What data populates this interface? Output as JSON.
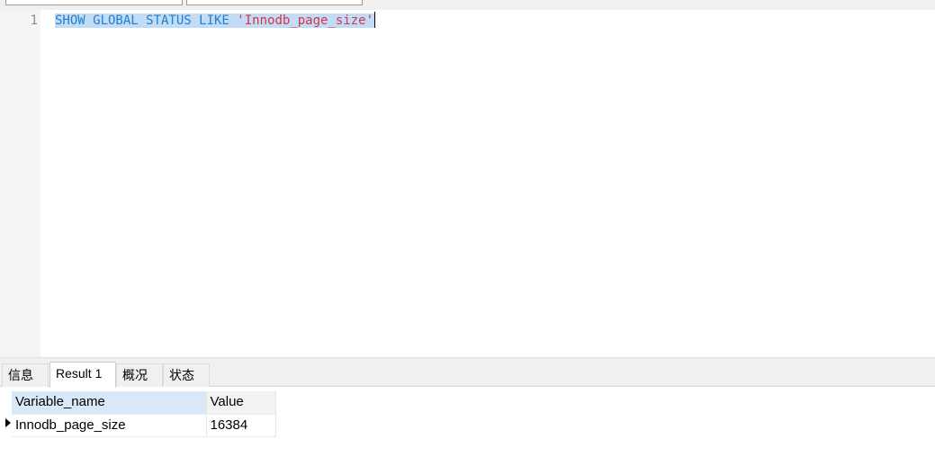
{
  "editor": {
    "line_numbers": [
      "1"
    ],
    "code": {
      "keywords": "SHOW GLOBAL STATUS LIKE ",
      "string": "'Innodb_page_size'"
    }
  },
  "result_tabs": [
    {
      "label": "信息"
    },
    {
      "label": "Result 1"
    },
    {
      "label": "概况"
    },
    {
      "label": "状态"
    }
  ],
  "active_tab": "Result 1",
  "grid": {
    "columns": [
      "Variable_name",
      "Value"
    ],
    "rows": [
      [
        "Innodb_page_size",
        "16384"
      ]
    ]
  },
  "colors": {
    "keyword": "#1f7fd1",
    "string": "#d6324a",
    "selection": "#c3dcf5",
    "selected_header": "#d8e8f8"
  }
}
